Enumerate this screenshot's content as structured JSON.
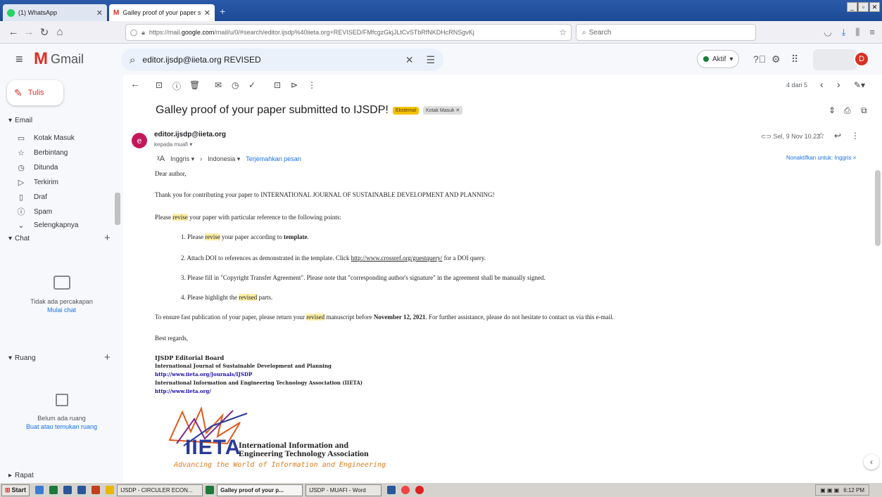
{
  "browser": {
    "tabs": [
      {
        "label": "(1) WhatsApp"
      },
      {
        "label": "Galley proof of your paper submitt"
      }
    ],
    "url_prefix": "https://mail.",
    "url_domain": "google.com",
    "url_rest": "/mail/u/0/#search/editor.ijsdp%40iieta.org+REVISED/FMfcgzGkjJLtCvSTbRfNKDHcRNSgvKj",
    "search_placeholder": "Search"
  },
  "gmail": {
    "app_name": "Gmail",
    "search_value": "editor.ijsdp@iieta.org REVISED",
    "status": "Aktif",
    "avatar_letter": "D"
  },
  "sidebar": {
    "compose_label": "Tulis",
    "email_section": "Email",
    "items": [
      {
        "icon": "inbox-icon",
        "label": "Kotak Masuk"
      },
      {
        "icon": "star-icon",
        "label": "Berbintang"
      },
      {
        "icon": "clock-icon",
        "label": "Ditunda"
      },
      {
        "icon": "send-icon",
        "label": "Terkirim"
      },
      {
        "icon": "draft-icon",
        "label": "Draf"
      },
      {
        "icon": "spam-icon",
        "label": "Spam"
      },
      {
        "icon": "chevron-down-icon",
        "label": "Selengkapnya"
      }
    ],
    "chat_section": "Chat",
    "chat_empty": "Tidak ada percakapan",
    "chat_start": "Mulai chat",
    "rooms_section": "Ruang",
    "rooms_empty": "Belum ada ruang",
    "rooms_link": "Buat atau temukan ruang",
    "meet_section": "Rapat"
  },
  "toolbar": {
    "pagination": "4 dari 5"
  },
  "email": {
    "subject": "Galley proof of your paper submitted to IJSDP!",
    "label_external": "Eksternal",
    "label_inbox": "Kotak Masuk",
    "sender": "editor.ijsdp@iieta.org",
    "to": "kepada muafi",
    "date": "Sel, 9 Nov 10.22",
    "translate_from": "Inggris",
    "translate_to": "Indonesia",
    "translate_link": "Terjemahkan pesan",
    "disable_translate": "Nonaktifkan untuk: Inggris",
    "greeting": "Dear author,",
    "p1": "Thank you for contributing your paper to INTERNATIONAL JOURNAL OF SUSTAINABLE DEVELOPMENT AND PLANNING!",
    "p2_a": "Please ",
    "hl_revise": "revise",
    "p2_b": " your paper with particular reference to the following points:",
    "li1_a": "1.   Please ",
    "li1_b": " your paper according to ",
    "li1_bold": "template",
    "li1_c": ".",
    "li2_a": "2.   Attach DOI to references as demonstrated in the template. Click ",
    "li2_link": "http://www.crossref.org/guestquery/",
    "li2_b": " for a DOI query.",
    "li3": "3.   Please fill in \"Copyright Transfer Agreement\". Please note that \"corresponding author's signature\" in the agreement shall be manually signed.",
    "li4_a": "4.   Please highlight the ",
    "hl_revised": "revised",
    "li4_b": " parts.",
    "p3_a": "To ensure fast publication of your paper, please return your ",
    "p3_b": " manuscript before ",
    "p3_date": "November 12, 2021",
    "p3_c": ". For further assistance, please do not hesitate to contact us via this e-mail.",
    "regards": "Best regards,",
    "sig1": "IJSDP Editorial Board",
    "sig2": "International Journal of Sustainable Development and Planning",
    "sig3": "http://www.iieta.org/Journals/IJSDP",
    "sig4": "International Information and Engineering Technology Association (IIETA)",
    "sig5": "http://www.iieta.org/",
    "logo_text": "IIETA",
    "logo_line1": "International Information and",
    "logo_line2": "Engineering Technology Association",
    "logo_tagline": "Advancing the World of Information and Engineering"
  },
  "taskbar": {
    "start": "Start",
    "tasks": [
      {
        "label": "IJSDP - CIRCULER ECON..."
      },
      {
        "label": "Galley proof of your p..."
      },
      {
        "label": "IJSDP - MUAFI - Word"
      }
    ],
    "time": "6:12 PM"
  }
}
